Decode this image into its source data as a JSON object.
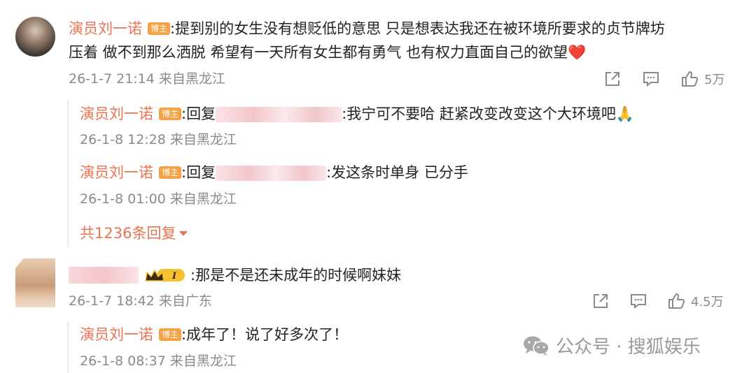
{
  "comment1": {
    "author": "演员刘一诺",
    "badge": "博主",
    "text_line1": ":提到别的女生没有想贬低的意思 只是想表达我还在被环境所要求的贞节牌坊",
    "text_line2": "压着 做不到那么洒脱 希望有一天所有女生都有勇气 也有权力直面自己的欲望❤️",
    "time": "26-1-7 21:14 来自黑龙江",
    "likes": "5万"
  },
  "reply1": {
    "author": "演员刘一诺",
    "badge": "博主",
    "reply_prefix": ":回复",
    "text": ":我宁可不要哈 赶紧改变改变这个大环境吧🙏",
    "time": "26-1-8 12:28 来自黑龙江"
  },
  "reply2": {
    "author": "演员刘一诺",
    "badge": "博主",
    "reply_prefix": ":回复",
    "text": ":发这条时单身 已分手",
    "time": "26-1-8 01:00 来自黑龙江"
  },
  "more_replies": "共1236条回复",
  "comment2": {
    "text": ":那是不是还未成年的时候啊妹妹",
    "time": "26-1-7 18:42 来自广东",
    "likes": "4.5万",
    "crown_level": "I"
  },
  "reply3": {
    "author": "演员刘一诺",
    "badge": "博主",
    "text": ":成年了！说了好多次了！",
    "time": "26-1-8 08:37 来自黑龙江"
  },
  "watermark": "公众号 · 搜狐娱乐",
  "colors": {
    "accent": "#eb7350",
    "badge": "#f7a145",
    "meta": "#8a8a8a"
  }
}
